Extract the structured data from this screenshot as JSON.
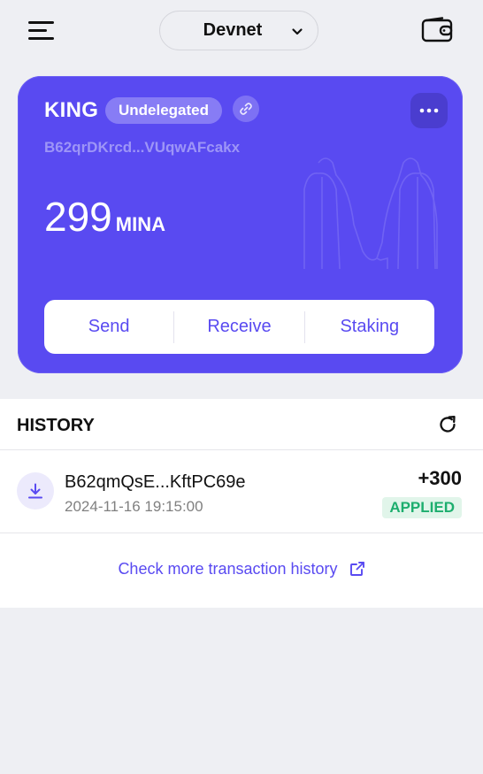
{
  "header": {
    "network": "Devnet",
    "menu_icon": "hamburger-menu-icon",
    "wallet_icon": "wallet-icon"
  },
  "account": {
    "name": "KING",
    "delegation_status": "Undelegated",
    "address": "B62qrDKrcd...VUqwAFcakx",
    "balance": "299",
    "unit": "MINA",
    "actions": {
      "send": "Send",
      "receive": "Receive",
      "staking": "Staking"
    }
  },
  "history": {
    "title": "HISTORY",
    "transactions": [
      {
        "address": "B62qmQsE...KftPC69e",
        "time": "2024-11-16 19:15:00",
        "amount": "+300",
        "status": "APPLIED",
        "direction": "receive"
      }
    ],
    "more_link": "Check more transaction history"
  },
  "colors": {
    "accent": "#594AF1",
    "background": "#EEEFF3",
    "applied_green": "#1DAE6E"
  }
}
